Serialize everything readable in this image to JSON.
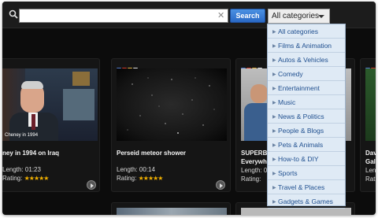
{
  "search": {
    "placeholder": "",
    "button_label": "Search"
  },
  "category_select": {
    "selected": "All categories"
  },
  "category_options": [
    "All categories",
    "Films & Animation",
    "Autos & Vehicles",
    "Comedy",
    "Entertainment",
    "Music",
    "News & Politics",
    "People & Blogs",
    "Pets & Animals",
    "How-to & DIY",
    "Sports",
    "Travel & Places",
    "Gadgets & Games"
  ],
  "videos": [
    {
      "title": "ney in 1994 on Iraq",
      "length": "Length: 01:23",
      "rating_label": "Rating:",
      "stars": "★★★★★",
      "caption": "Cheney in 1994"
    },
    {
      "title": "Perseid meteor shower",
      "length": "Length: 00:14",
      "rating_label": "Rating:",
      "stars": "★★★★★"
    },
    {
      "title": "SUPERB",
      "title2": "Everywh",
      "length": "Length: 0",
      "rating_label": "Rating:"
    },
    {
      "title": "Dav",
      "title2": "Gala",
      "length": "Leng",
      "rating_label": "Ratin"
    }
  ],
  "colors": {
    "accent": "#2a69c5",
    "stars": "#f2b100",
    "dropdown_bg": "#dfeaf5"
  }
}
